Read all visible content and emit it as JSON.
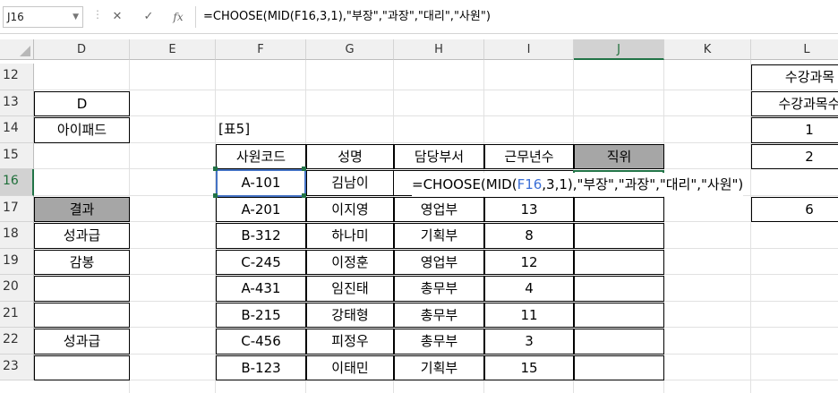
{
  "formula_bar": {
    "name_box": "J16",
    "cancel_icon": "✕",
    "enter_icon": "✓",
    "fx_label": "fx",
    "formula": "=CHOOSE(MID(F16,3,1),\"부장\",\"과장\",\"대리\",\"사원\")"
  },
  "columns": [
    "D",
    "E",
    "F",
    "G",
    "H",
    "I",
    "J",
    "K",
    "L"
  ],
  "selected_column": "J",
  "rows": [
    "12",
    "13",
    "14",
    "15",
    "16",
    "17",
    "18",
    "19",
    "20",
    "21",
    "22",
    "23"
  ],
  "selected_row": "16",
  "cells": {
    "D13": "D",
    "D14": "아이패드",
    "D17": "결과",
    "D18": "성과급",
    "D19": "감봉",
    "D22": "성과급",
    "F14": "[표5]",
    "L12": "수강과목",
    "L13": "수강과목수",
    "L14": "1",
    "L15": "2",
    "L17": "6"
  },
  "table": {
    "headers": [
      "사원코드",
      "성명",
      "담당부서",
      "근무년수",
      "직위"
    ],
    "rows": [
      [
        "A-101",
        "김남이",
        "",
        "",
        ""
      ],
      [
        "A-201",
        "이지영",
        "영업부",
        "13",
        ""
      ],
      [
        "B-312",
        "하나미",
        "기획부",
        "8",
        ""
      ],
      [
        "C-245",
        "이정훈",
        "영업부",
        "12",
        ""
      ],
      [
        "A-431",
        "임진태",
        "총무부",
        "4",
        ""
      ],
      [
        "B-215",
        "강태형",
        "총무부",
        "11",
        ""
      ],
      [
        "C-456",
        "피정우",
        "총무부",
        "3",
        ""
      ],
      [
        "B-123",
        "이태민",
        "기획부",
        "15",
        ""
      ]
    ]
  },
  "edit": {
    "prefix": "=CHOOSE(MID(",
    "ref": "F16",
    "suffix": ",3,1),\"부장\",\"과장\",\"대리\",\"사원\")"
  }
}
